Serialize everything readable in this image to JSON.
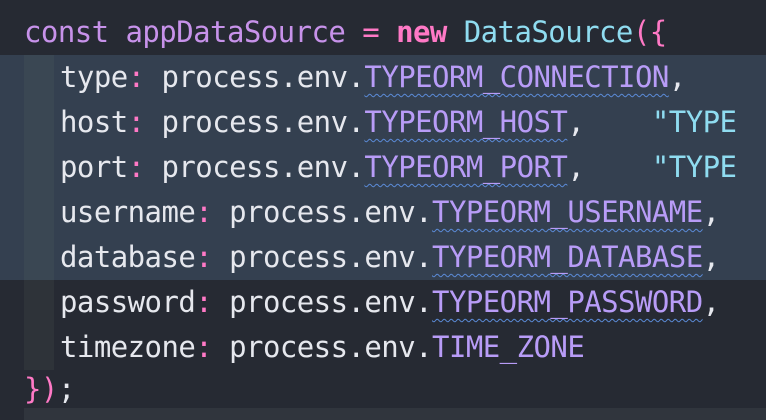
{
  "editor": {
    "lines": [
      {
        "tokens": [
          "const",
          "appDataSource",
          "=",
          "new",
          "DataSource",
          "({"
        ]
      },
      {
        "prop": "type",
        "obj": "process.env.",
        "const": "TYPEORM_CONNECTION",
        "trail": ","
      },
      {
        "prop": "host",
        "obj": "process.env.",
        "const": "TYPEORM_HOST",
        "trail": ",",
        "str": "\"TYPE"
      },
      {
        "prop": "port",
        "obj": "process.env.",
        "const": "TYPEORM_PORT",
        "trail": ",",
        "str": "\"TYPE"
      },
      {
        "prop": "username",
        "obj": "process.env.",
        "const": "TYPEORM_USERNAME",
        "trail": ","
      },
      {
        "prop": "database",
        "obj": "process.env.",
        "const": "TYPEORM_DATABASE",
        "trail": ","
      },
      {
        "prop": "password",
        "obj": "process.env.",
        "const": "TYPEORM_PASSWORD",
        "trail": ","
      },
      {
        "prop": "timezone",
        "obj": "process.env.",
        "const": "TIME_ZONE",
        "trail": ""
      },
      {
        "tokens": [
          "})",
          ";"
        ]
      }
    ],
    "colors": {
      "background": "#262a33",
      "selection": "#344050",
      "keyword": "#c792ea",
      "operator": "#ff79c6",
      "class_name": "#8fdcf0",
      "env_constant": "#b89cf7",
      "text": "#e6e8ee"
    }
  }
}
